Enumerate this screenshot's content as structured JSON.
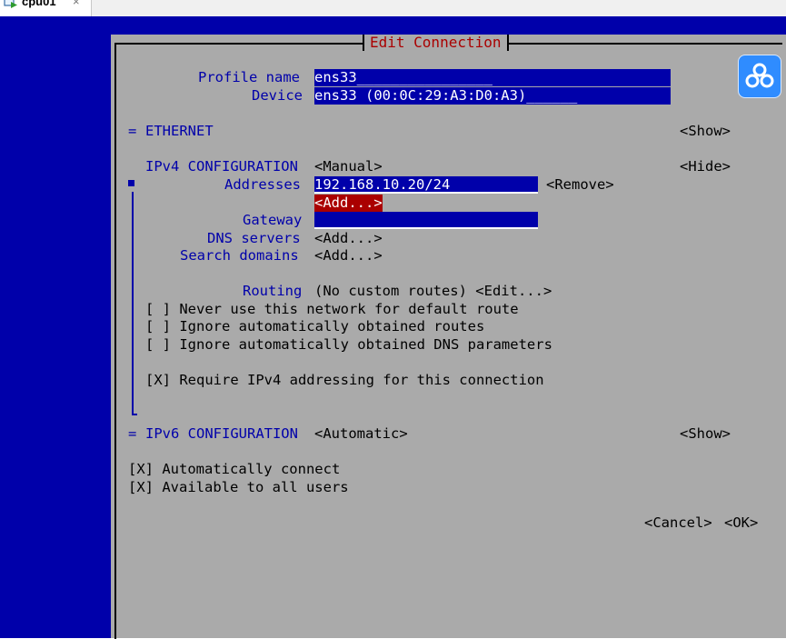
{
  "host_tab": {
    "title": "cpu01",
    "close": "×"
  },
  "dialog": {
    "title": "Edit Connection",
    "profile_name_label": "Profile name",
    "profile_name_value": "ens33________________",
    "device_label": "Device",
    "device_value": "ens33 (00:0C:29:A3:D0:A3)______",
    "ethernet": {
      "marker": "=",
      "label": "ETHERNET",
      "action": "<Show>"
    },
    "ipv4": {
      "label": "IPv4 CONFIGURATION",
      "mode": "<Manual>",
      "action": "<Hide>",
      "addresses_label": "Addresses",
      "address_value": "192.168.10.20/24________",
      "remove": "<Remove>",
      "add_address": "<Add...>",
      "gateway_label": "Gateway",
      "gateway_value": "",
      "dns_label": "DNS servers",
      "dns_add": "<Add...>",
      "search_label": "Search domains",
      "search_add": "<Add...>",
      "routing_label": "Routing",
      "routing_value": "(No custom routes) <Edit...>",
      "opt_default_route": "[ ] Never use this network for default route",
      "opt_ignore_routes": "[ ] Ignore automatically obtained routes",
      "opt_ignore_dns": "[ ] Ignore automatically obtained DNS parameters",
      "opt_require_ipv4": "[X] Require IPv4 addressing for this connection"
    },
    "ipv6": {
      "marker": "=",
      "label": "IPv6 CONFIGURATION",
      "mode": "<Automatic>",
      "action": "<Show>"
    },
    "auto_connect": "[X] Automatically connect",
    "all_users": "[X] Available to all users",
    "cancel": "<Cancel>",
    "ok": "<OK>"
  },
  "icons": {
    "tab": "vm-console-icon",
    "floating": "cloud-app-icon"
  },
  "colors": {
    "terminal_bg": "#0000aa",
    "dialog_bg": "#aaaaaa",
    "label": "#0000aa",
    "title": "#aa0000",
    "selected": "#aa0000"
  }
}
